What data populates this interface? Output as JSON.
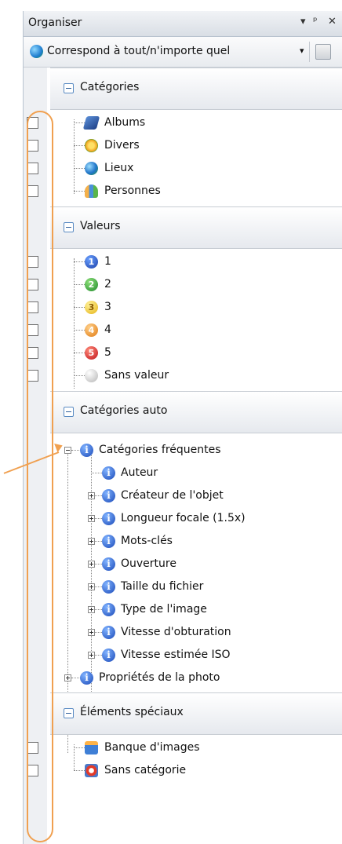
{
  "panel": {
    "title": "Organiser",
    "controls": [
      "▾",
      "ᵖ",
      "✕"
    ]
  },
  "toolbar": {
    "mode_label": "Correspond à tout/n'importe quel",
    "dropdown": "▾"
  },
  "sections": {
    "categories": {
      "label": "Catégories",
      "items": [
        "Albums",
        "Divers",
        "Lieux",
        "Personnes"
      ]
    },
    "values": {
      "label": "Valeurs",
      "items": [
        "1",
        "2",
        "3",
        "4",
        "5",
        "Sans valeur"
      ]
    },
    "auto": {
      "label": "Catégories auto",
      "parent": "Catégories fréquentes",
      "children": [
        "Auteur",
        "Créateur de l'objet",
        "Longueur focale (1.5x)",
        "Mots-clés",
        "Ouverture",
        "Taille du fichier",
        "Type de l'image",
        "Vitesse d'obturation",
        "Vitesse estimée ISO"
      ],
      "sibling": "Propriétés de la photo"
    },
    "special": {
      "label": "Éléments spéciaux",
      "items": [
        "Banque d'images",
        "Sans catégorie"
      ]
    }
  },
  "badges": [
    "1",
    "2",
    "3",
    "4",
    "5"
  ],
  "info_glyph": "i",
  "colors": {
    "annotation": "#f0a050",
    "accent": "#2f5f9b"
  }
}
